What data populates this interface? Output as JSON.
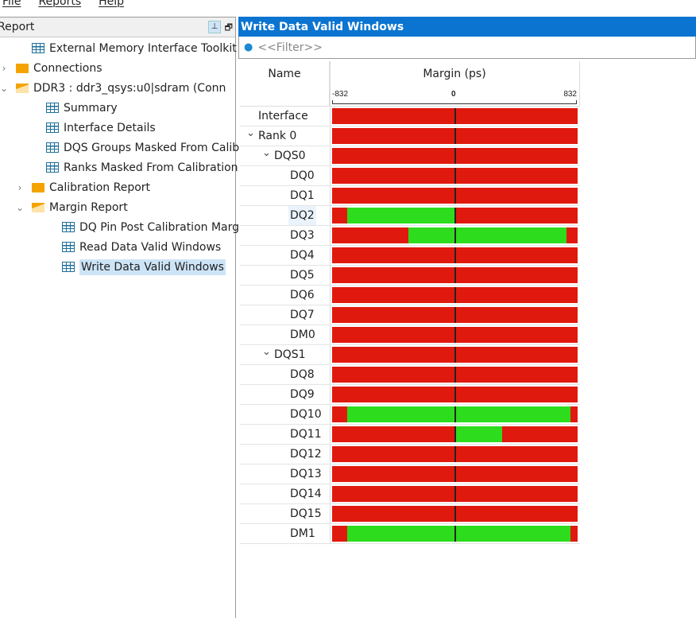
{
  "menu": [
    "File",
    "Reports",
    "Help"
  ],
  "left_panel": {
    "title": "Report",
    "pin_icon": "pin-icon",
    "tree": [
      {
        "label": "External Memory Interface Toolkit",
        "icon": "grid",
        "level": 2
      },
      {
        "label": "Connections",
        "icon": "folder",
        "level": 1,
        "chevron": "right"
      },
      {
        "label": "DDR3 : ddr3_qsys:u0|sdram (Conn",
        "icon": "folder-open",
        "level": 1,
        "chevron": "down"
      },
      {
        "label": "Summary",
        "icon": "grid",
        "level": 3
      },
      {
        "label": "Interface Details",
        "icon": "grid",
        "level": 3
      },
      {
        "label": "DQS Groups Masked From Calib",
        "icon": "grid",
        "level": 3
      },
      {
        "label": "Ranks Masked From Calibration",
        "icon": "grid",
        "level": 3
      },
      {
        "label": "Calibration Report",
        "icon": "folder",
        "level": 2,
        "chevron": "right"
      },
      {
        "label": "Margin Report",
        "icon": "folder-open",
        "level": 2,
        "chevron": "down"
      },
      {
        "label": "DQ Pin Post Calibration Marg",
        "icon": "grid",
        "level": 4
      },
      {
        "label": "Read Data Valid Windows",
        "icon": "grid",
        "level": 4
      },
      {
        "label": "Write Data Valid Windows",
        "icon": "grid",
        "level": 4,
        "selected": true
      }
    ]
  },
  "right_panel": {
    "title": "Write Data Valid Windows",
    "filter_placeholder": "<<Filter>>"
  },
  "chart_data": {
    "type": "bar",
    "title": "Margin (ps)",
    "name_header": "Name",
    "xlim": [
      -832,
      832
    ],
    "tick_labels": [
      "-832",
      "0",
      "832"
    ],
    "colors": {
      "fail": "#e0190e",
      "pass": "#2ddc1c"
    },
    "rows": [
      {
        "name": "Interface",
        "level": 0,
        "pass": null
      },
      {
        "name": "Rank 0",
        "level": 0,
        "chevron": true,
        "pass": null
      },
      {
        "name": "DQS0",
        "level": 1,
        "chevron": true,
        "pass": null
      },
      {
        "name": "DQ0",
        "level": 2,
        "pass": null
      },
      {
        "name": "DQ1",
        "level": 2,
        "pass": null
      },
      {
        "name": "DQ2",
        "level": 2,
        "pass": [
          -730,
          0
        ],
        "highlight": true
      },
      {
        "name": "DQ3",
        "level": 2,
        "pass": [
          -315,
          759
        ]
      },
      {
        "name": "DQ4",
        "level": 2,
        "pass": null
      },
      {
        "name": "DQ5",
        "level": 2,
        "pass": null
      },
      {
        "name": "DQ6",
        "level": 2,
        "pass": null
      },
      {
        "name": "DQ7",
        "level": 2,
        "pass": null
      },
      {
        "name": "DM0",
        "level": 2,
        "pass": null
      },
      {
        "name": "DQS1",
        "level": 1,
        "chevron": true,
        "pass": null
      },
      {
        "name": "DQ8",
        "level": 2,
        "pass": null
      },
      {
        "name": "DQ9",
        "level": 2,
        "pass": null
      },
      {
        "name": "DQ10",
        "level": 2,
        "pass": [
          -730,
          786
        ]
      },
      {
        "name": "DQ11",
        "level": 2,
        "pass": [
          0,
          318
        ]
      },
      {
        "name": "DQ12",
        "level": 2,
        "pass": null
      },
      {
        "name": "DQ13",
        "level": 2,
        "pass": null
      },
      {
        "name": "DQ14",
        "level": 2,
        "pass": null
      },
      {
        "name": "DQ15",
        "level": 2,
        "pass": null
      },
      {
        "name": "DM1",
        "level": 2,
        "pass": [
          -730,
          786
        ]
      }
    ]
  }
}
